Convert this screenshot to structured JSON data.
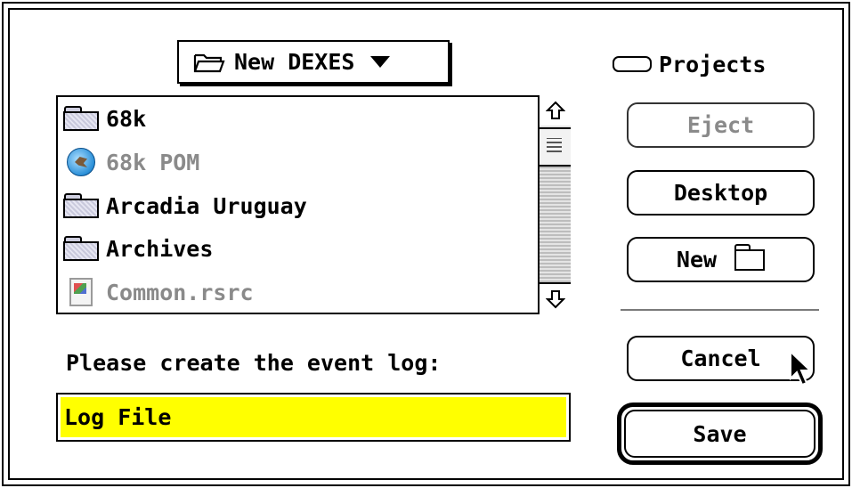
{
  "dialog": {
    "folder_popup": {
      "label": "New DEXES",
      "icon": "open-folder-icon"
    },
    "disk": {
      "label": "Projects",
      "icon": "drive-icon"
    },
    "file_list": {
      "items": [
        {
          "name": "68k",
          "icon": "folder-icon",
          "enabled": true
        },
        {
          "name": "68k POM",
          "icon": "application-icon",
          "enabled": false
        },
        {
          "name": "Arcadia Uruguay",
          "icon": "folder-icon",
          "enabled": true
        },
        {
          "name": "Archives",
          "icon": "folder-icon",
          "enabled": true
        },
        {
          "name": "Common.rsrc",
          "icon": "resource-file-icon",
          "enabled": false
        }
      ]
    },
    "buttons": {
      "eject": "Eject",
      "desktop": "Desktop",
      "new": "New",
      "cancel": "Cancel",
      "save": "Save"
    },
    "prompt": "Please create the event log:",
    "filename": {
      "value": "Log File"
    },
    "colors": {
      "selection_highlight": "#ffff00",
      "disabled_text": "#8a8a8a"
    }
  }
}
